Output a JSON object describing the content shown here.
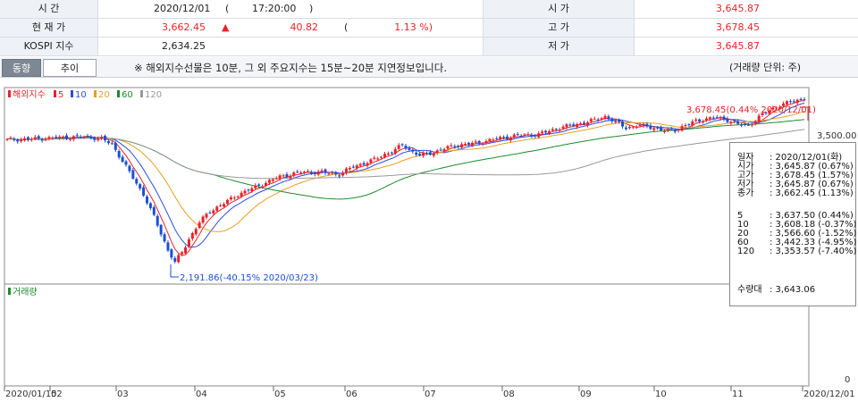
{
  "info": {
    "time_label": "시 간",
    "date": "2020/12/01",
    "paren_open": "(",
    "time": "17:20:00",
    "paren_close": ")",
    "price_label": "현 재 가",
    "price": "3,662.45",
    "change_arrow": "▲",
    "change": "40.82",
    "pct_open": "(",
    "change_pct": "1.13 %)",
    "index_label": "KOSPI 지수",
    "kospi": "2,634.25",
    "open_label": "시 가",
    "open": "3,645.87",
    "high_label": "고 가",
    "high": "3,678.45",
    "low_label": "저 가",
    "low": "3,645.87"
  },
  "tabs": [
    {
      "label": "동향"
    },
    {
      "label": "추이"
    }
  ],
  "notice": "※ 해외지수선물은 10분, 그 외 주요지수는 15분~20분 지연정보입니다.",
  "volume_unit": "(거래량 단위: 주)",
  "legend": {
    "name": "해외지수",
    "ma": [
      "5",
      "10",
      "20",
      "60",
      "120"
    ],
    "ma_colors": [
      "#e8232a",
      "#2b4de0",
      "#e6a020",
      "#1f8a2c",
      "#999999"
    ]
  },
  "volume_label": "거래량",
  "annotations": {
    "high": "3,678.45(0.44% 2020/12/01)",
    "low": "2,191.86(-40.15% 2020/03/23)"
  },
  "y_tick": "3,500.00",
  "x_labels": [
    "2020/01/15",
    "02",
    "03",
    "04",
    "05",
    "06",
    "07",
    "08",
    "09",
    "10",
    "11",
    "2020/12/01"
  ],
  "volume_zero": "0",
  "tooltip": {
    "rows": [
      {
        "label": "일자",
        "value": ": 2020/12/01(화)"
      },
      {
        "label": "시가",
        "value": ": 3,645.87 (0.67%)"
      },
      {
        "label": "고가",
        "value": ": 3,678.45 (1.57%)"
      },
      {
        "label": "저가",
        "value": ": 3,645.87 (0.67%)"
      },
      {
        "label": "종가",
        "value": ": 3,662.45 (1.13%)"
      }
    ],
    "ma_rows": [
      {
        "label": "5",
        "value": ": 3,637.50 (0.44%)"
      },
      {
        "label": "10",
        "value": ": 3,608.18 (-0.37%)"
      },
      {
        "label": "20",
        "value": ": 3,566.60 (-1.52%)"
      },
      {
        "label": "60",
        "value": ": 3,442.33 (-4.95%)"
      },
      {
        "label": "120",
        "value": ": 3,353.57 (-7.40%)"
      }
    ],
    "volume_row": {
      "label": "수량대",
      "value": ": 3,643.06"
    }
  },
  "chart_data": {
    "type": "candlestick",
    "x_range": [
      "2020/01/15",
      "2020/12/01"
    ],
    "y_range": [
      2100,
      3720
    ],
    "series": [
      {
        "name": "해외지수",
        "kind": "ohlc"
      },
      {
        "name": "5"
      },
      {
        "name": "10"
      },
      {
        "name": "20"
      },
      {
        "name": "60"
      },
      {
        "name": "120"
      }
    ],
    "close_path": [
      [
        0,
        3290
      ],
      [
        8,
        3300
      ],
      [
        15,
        3310
      ],
      [
        22,
        3320
      ],
      [
        27,
        3300
      ],
      [
        30,
        3250
      ],
      [
        33,
        3100
      ],
      [
        36,
        2950
      ],
      [
        39,
        2800
      ],
      [
        42,
        2600
      ],
      [
        44,
        2450
      ],
      [
        46,
        2300
      ],
      [
        48,
        2192
      ],
      [
        50,
        2280
      ],
      [
        52,
        2400
      ],
      [
        55,
        2550
      ],
      [
        58,
        2650
      ],
      [
        62,
        2720
      ],
      [
        66,
        2800
      ],
      [
        72,
        2880
      ],
      [
        78,
        2960
      ],
      [
        84,
        3000
      ],
      [
        90,
        3000
      ],
      [
        95,
        2980
      ],
      [
        99,
        3050
      ],
      [
        104,
        3100
      ],
      [
        108,
        3160
      ],
      [
        111,
        3200
      ],
      [
        113,
        3250
      ],
      [
        115,
        3200
      ],
      [
        118,
        3150
      ],
      [
        122,
        3180
      ],
      [
        128,
        3240
      ],
      [
        134,
        3260
      ],
      [
        140,
        3300
      ],
      [
        146,
        3330
      ],
      [
        152,
        3340
      ],
      [
        158,
        3400
      ],
      [
        163,
        3430
      ],
      [
        167,
        3460
      ],
      [
        171,
        3500
      ],
      [
        174,
        3450
      ],
      [
        177,
        3400
      ],
      [
        181,
        3420
      ],
      [
        185,
        3400
      ],
      [
        188,
        3370
      ],
      [
        191,
        3380
      ],
      [
        194,
        3420
      ],
      [
        197,
        3460
      ],
      [
        200,
        3480
      ],
      [
        203,
        3490
      ],
      [
        206,
        3470
      ],
      [
        209,
        3430
      ],
      [
        212,
        3420
      ],
      [
        216,
        3520
      ],
      [
        220,
        3590
      ],
      [
        224,
        3630
      ],
      [
        228,
        3662
      ]
    ]
  }
}
